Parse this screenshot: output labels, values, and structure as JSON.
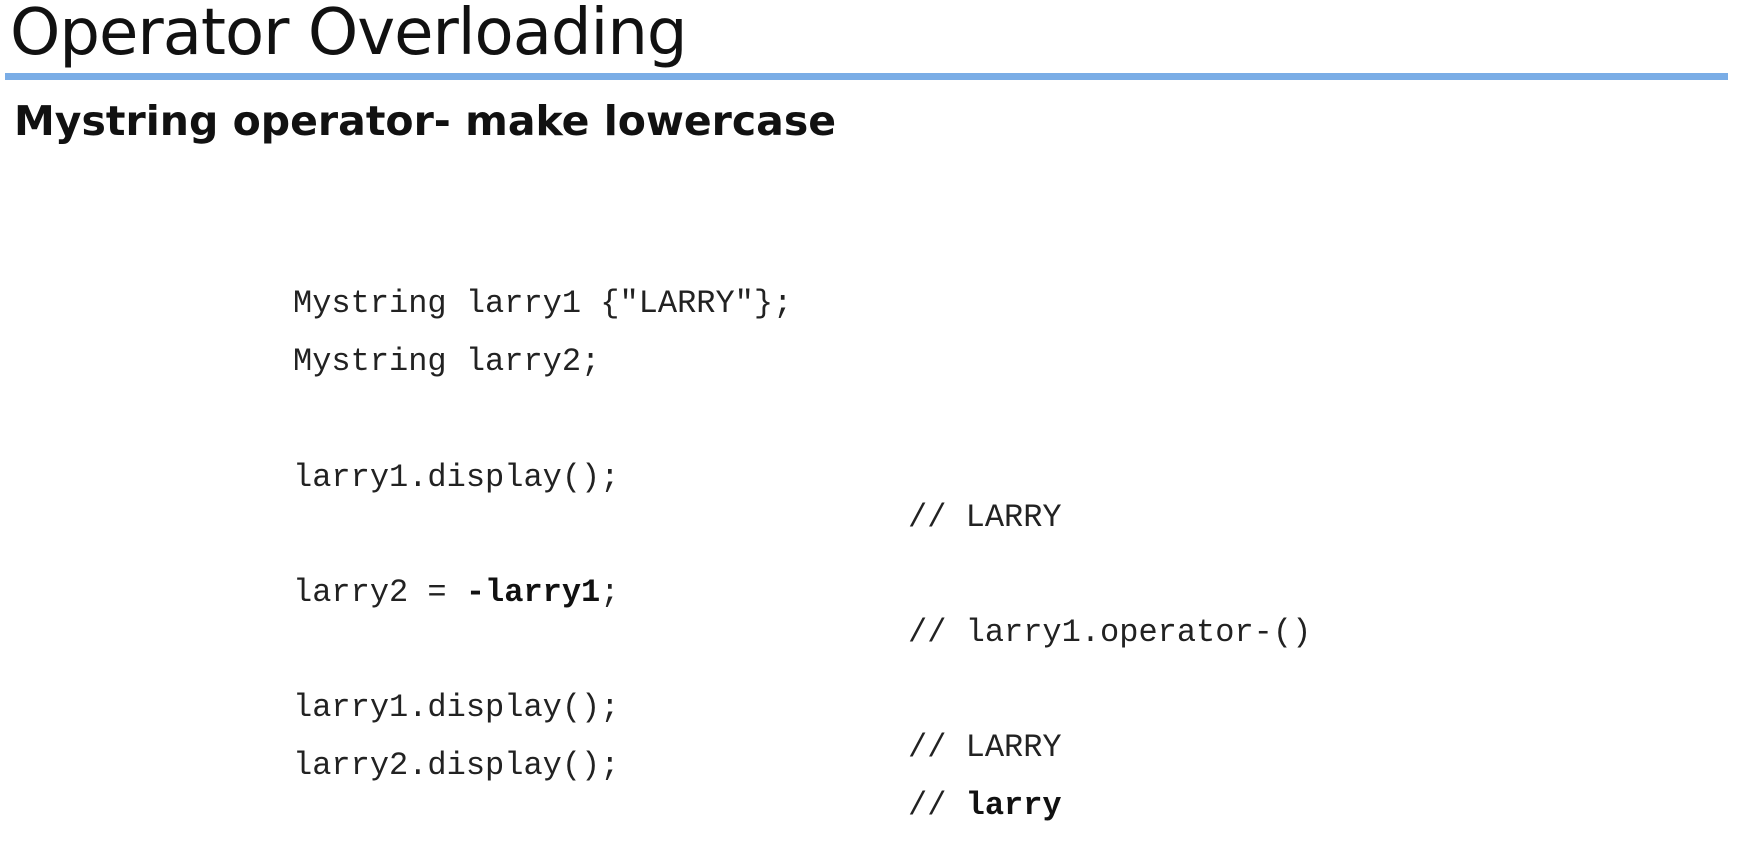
{
  "slide": {
    "title": "Operator Overloading",
    "subtitle": "Mystring  operator- make lowercase",
    "accent_color": "#7aade6"
  },
  "code": {
    "line1": "Mystring larry1 {\"LARRY\"};",
    "line2": "Mystring larry2;",
    "line3": {
      "stmt": "larry1.display();",
      "comment": "// LARRY"
    },
    "line4": {
      "stmt_prefix": "larry2 = ",
      "stmt_bold": "-larry1",
      "stmt_suffix": ";",
      "comment": "// larry1.operator-()"
    },
    "line5": {
      "stmt": "larry1.display();",
      "comment": "// LARRY"
    },
    "line6": {
      "stmt": "larry2.display();",
      "comment_prefix": "// ",
      "comment_bold": "larry"
    }
  }
}
